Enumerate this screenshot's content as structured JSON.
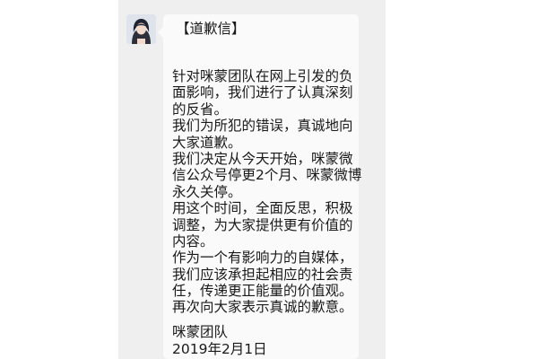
{
  "message": {
    "title": "【道歉信】",
    "lines": [
      "针对咪蒙团队在网上引发的负",
      "面影响，我们进行了认真深刻",
      "的反省。",
      "我们为所犯的错误，真诚地向",
      "大家道歉。",
      "我们决定从今天开始，咪蒙微",
      "信公众号停更2个月、咪蒙微博",
      "永久关停。",
      "用这个时间，全面反思，积极",
      "调整，为大家提供更有价值的",
      "内容。",
      "作为一个有影响力的自媒体，",
      "我们应该承担起相应的社会责",
      "任，传递更正能量的价值观。",
      "再次向大家表示真诚的歉意。"
    ],
    "signature": {
      "team": "咪蒙团队",
      "date": "2019年2月1日"
    }
  },
  "avatar": {
    "icon": "user-avatar-icon"
  }
}
